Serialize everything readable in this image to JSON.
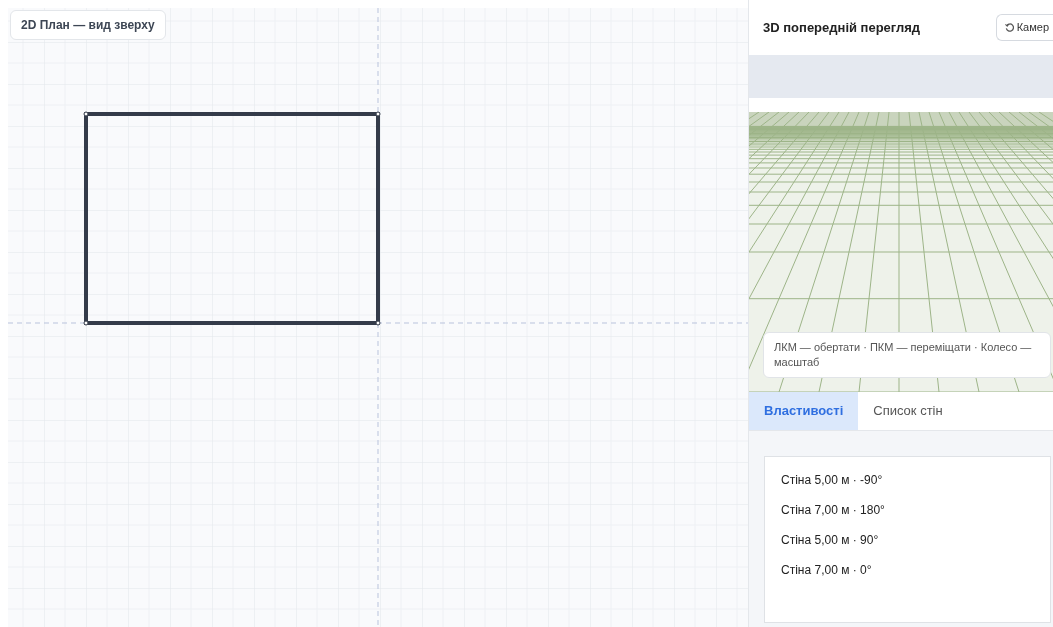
{
  "plan": {
    "title": "2D План — вид зверху"
  },
  "preview": {
    "title": "3D попередній перегляд",
    "camera_button": "Камер",
    "hint": "ЛКМ — обертати · ПКМ — переміщати · Колесо — масштаб"
  },
  "tabs": [
    {
      "label": "Властивості",
      "selected": true
    },
    {
      "label": "Список стін",
      "selected": false
    }
  ],
  "walls": [
    {
      "label": "Стіна 5,00 м · -90°"
    },
    {
      "label": "Стіна 7,00 м · 180°"
    },
    {
      "label": "Стіна 5,00 м · 90°"
    },
    {
      "label": "Стіна 7,00 м · 0°"
    }
  ]
}
